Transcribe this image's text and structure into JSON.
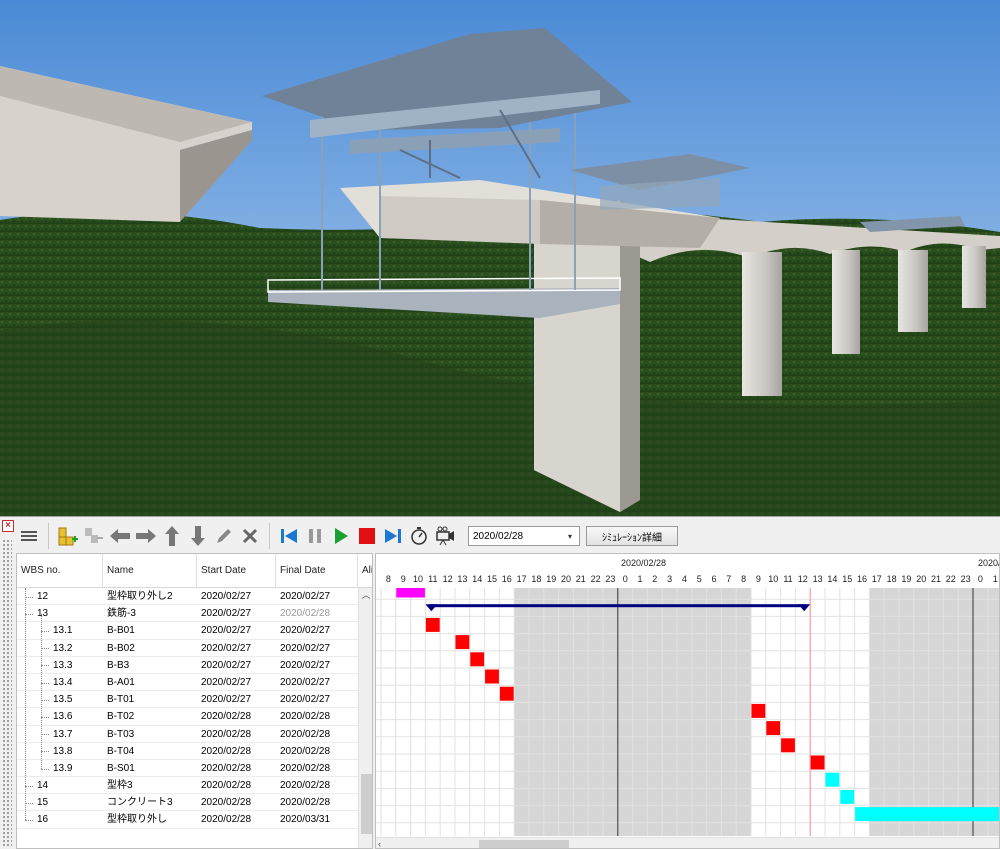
{
  "toolbar": {
    "date_value": "2020/02/28",
    "simulation_detail_label": "ｼﾐｭﾚｰｼｮﾝ詳細"
  },
  "table": {
    "headers": {
      "wbs": "WBS no.",
      "name": "Name",
      "start": "Start Date",
      "final": "Final Date",
      "alias": "Alia"
    },
    "rows": [
      {
        "wbs": "12",
        "name": "型枠取り外し2",
        "start": "2020/02/27",
        "final": "2020/02/27"
      },
      {
        "wbs": "13",
        "name": "鉄筋-3",
        "start": "2020/02/27",
        "final": "2020/02/28"
      },
      {
        "wbs": "13.1",
        "name": "B-B01",
        "start": "2020/02/27",
        "final": "2020/02/27"
      },
      {
        "wbs": "13.2",
        "name": "B-B02",
        "start": "2020/02/27",
        "final": "2020/02/27"
      },
      {
        "wbs": "13.3",
        "name": "B-B3",
        "start": "2020/02/27",
        "final": "2020/02/27"
      },
      {
        "wbs": "13.4",
        "name": "B-A01",
        "start": "2020/02/27",
        "final": "2020/02/27"
      },
      {
        "wbs": "13.5",
        "name": "B-T01",
        "start": "2020/02/27",
        "final": "2020/02/27"
      },
      {
        "wbs": "13.6",
        "name": "B-T02",
        "start": "2020/02/28",
        "final": "2020/02/28"
      },
      {
        "wbs": "13.7",
        "name": "B-T03",
        "start": "2020/02/28",
        "final": "2020/02/28"
      },
      {
        "wbs": "13.8",
        "name": "B-T04",
        "start": "2020/02/28",
        "final": "2020/02/28"
      },
      {
        "wbs": "13.9",
        "name": "B-S01",
        "start": "2020/02/28",
        "final": "2020/02/28"
      },
      {
        "wbs": "14",
        "name": "型枠3",
        "start": "2020/02/28",
        "final": "2020/02/28"
      },
      {
        "wbs": "15",
        "name": "コンクリート3",
        "start": "2020/02/28",
        "final": "2020/02/28"
      },
      {
        "wbs": "16",
        "name": "型枠取り外し",
        "start": "2020/02/28",
        "final": "2020/03/31"
      }
    ]
  },
  "gantt": {
    "date_label_1": "2020/02/28",
    "date_label_2": "2020/",
    "hours": [
      "8",
      "9",
      "10",
      "11",
      "12",
      "13",
      "14",
      "15",
      "16",
      "17",
      "18",
      "19",
      "20",
      "21",
      "22",
      "23",
      "0",
      "1",
      "2",
      "3",
      "4",
      "5",
      "6",
      "7",
      "8",
      "9",
      "10",
      "11",
      "12",
      "13",
      "14",
      "15",
      "16",
      "17",
      "18",
      "19",
      "20",
      "21",
      "22",
      "23",
      "0",
      "1"
    ],
    "tasks": [
      {
        "row": 0,
        "start": 1,
        "end": 3,
        "kind": "bar",
        "color": "#ff00ff"
      },
      {
        "row": 1,
        "start": 3,
        "end": 29,
        "kind": "summary",
        "color": "#000080"
      },
      {
        "row": 2,
        "start": 3,
        "end": 4,
        "kind": "bar",
        "color": "#ff0000"
      },
      {
        "row": 3,
        "start": 5,
        "end": 6,
        "kind": "bar",
        "color": "#ff0000"
      },
      {
        "row": 4,
        "start": 6,
        "end": 7,
        "kind": "bar",
        "color": "#ff0000"
      },
      {
        "row": 5,
        "start": 7,
        "end": 8,
        "kind": "bar",
        "color": "#ff0000"
      },
      {
        "row": 6,
        "start": 8,
        "end": 9,
        "kind": "bar",
        "color": "#ff0000"
      },
      {
        "row": 7,
        "start": 25,
        "end": 26,
        "kind": "bar",
        "color": "#ff0000"
      },
      {
        "row": 8,
        "start": 26,
        "end": 27,
        "kind": "bar",
        "color": "#ff0000"
      },
      {
        "row": 9,
        "start": 27,
        "end": 28,
        "kind": "bar",
        "color": "#ff0000"
      },
      {
        "row": 10,
        "start": 29,
        "end": 30,
        "kind": "bar",
        "color": "#ff0000"
      },
      {
        "row": 11,
        "start": 30,
        "end": 31,
        "kind": "bar",
        "color": "#00ffff"
      },
      {
        "row": 12,
        "start": 31,
        "end": 32,
        "kind": "bar",
        "color": "#00ffff"
      },
      {
        "row": 13,
        "start": 32,
        "end": 42,
        "kind": "bar",
        "color": "#00ffff"
      }
    ]
  }
}
